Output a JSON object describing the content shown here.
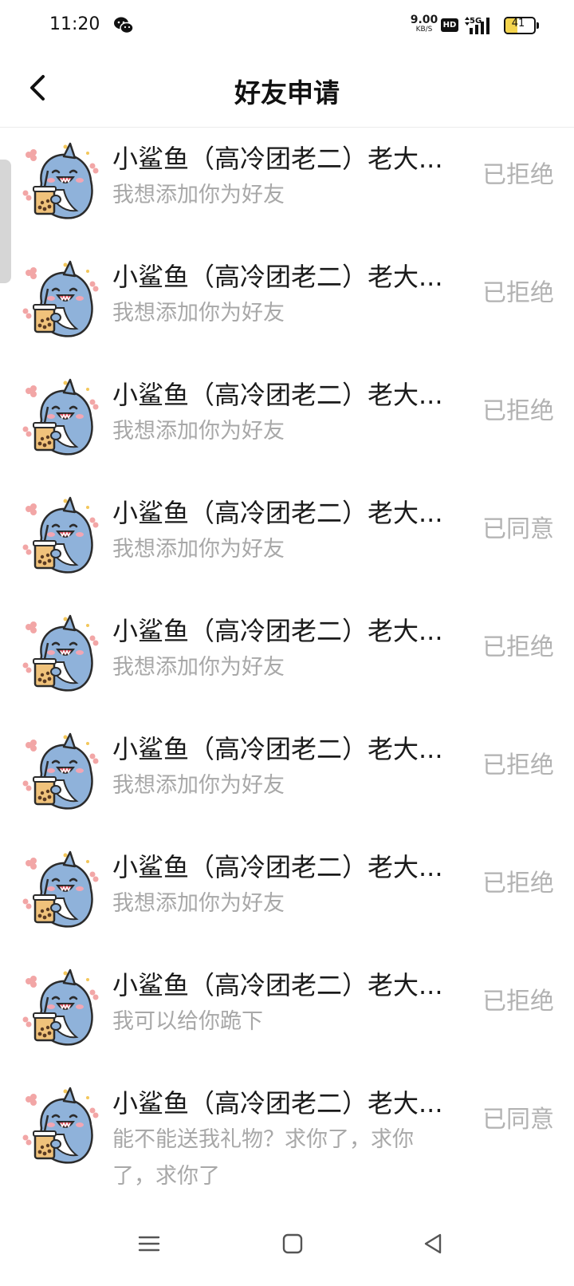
{
  "status_bar": {
    "time": "11:20",
    "net_speed_value": "9.00",
    "net_speed_unit": "KB/S",
    "hd_label": "HD",
    "network_label": "5G",
    "battery_level": "41",
    "battery_fraction": 0.41,
    "battery_fill_color": "#f4d44d",
    "icons": [
      "wechat-icon",
      "signal-icon",
      "battery-icon"
    ]
  },
  "header": {
    "title": "好友申请",
    "back_icon": "chevron-left-icon"
  },
  "requests": [
    {
      "name": "小鲨鱼（高冷团老二）老大...",
      "message": "我想添加你为好友",
      "status": "已拒绝"
    },
    {
      "name": "小鲨鱼（高冷团老二）老大...",
      "message": "我想添加你为好友",
      "status": "已拒绝"
    },
    {
      "name": "小鲨鱼（高冷团老二）老大...",
      "message": "我想添加你为好友",
      "status": "已拒绝"
    },
    {
      "name": "小鲨鱼（高冷团老二）老大...",
      "message": "我想添加你为好友",
      "status": "已同意"
    },
    {
      "name": "小鲨鱼（高冷团老二）老大...",
      "message": "我想添加你为好友",
      "status": "已拒绝"
    },
    {
      "name": "小鲨鱼（高冷团老二）老大...",
      "message": "我想添加你为好友",
      "status": "已拒绝"
    },
    {
      "name": "小鲨鱼（高冷团老二）老大...",
      "message": "我想添加你为好友",
      "status": "已拒绝"
    },
    {
      "name": "小鲨鱼（高冷团老二）老大...",
      "message": "我可以给你跪下",
      "status": "已拒绝"
    },
    {
      "name": "小鲨鱼（高冷团老二）老大...",
      "message": "能不能送我礼物？求你了，求你了，求你了",
      "status": "已同意"
    }
  ],
  "colors": {
    "status_text": "#b2b2b2",
    "message_text": "#a8a8a8",
    "avatar_shark": "#8fb2da",
    "avatar_tea": "#f0c27b"
  },
  "nav_bar": {
    "icons": [
      "menu-icon",
      "home-icon",
      "back-triangle-icon"
    ]
  }
}
